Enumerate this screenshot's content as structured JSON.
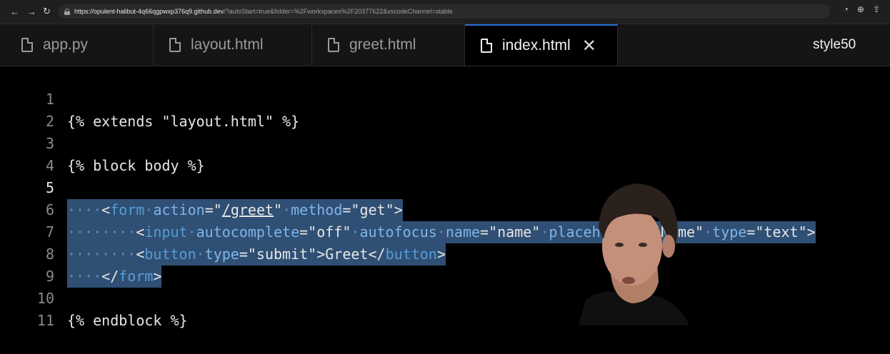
{
  "browser": {
    "url_host": "https://opulent-halibut-4q66qgpwxp376q9.github.dev",
    "url_rest": "/?autoStart=true&folder=%2Fworkspaces%2F20377622&vscodeChannel=stable"
  },
  "tabs": [
    {
      "label": "app.py"
    },
    {
      "label": "layout.html"
    },
    {
      "label": "greet.html"
    },
    {
      "label": "index.html"
    }
  ],
  "status_right": "style50",
  "editor": {
    "line_numbers": [
      "1",
      "2",
      "3",
      "4",
      "5",
      "6",
      "7",
      "8",
      "9",
      "10",
      "11"
    ],
    "lines": {
      "l1": "{% extends \"layout.html\" %}",
      "l3": "{% block body %}",
      "l5": {
        "ws": "····",
        "lt": "<",
        "tag": "form",
        "s1": "·",
        "a1": "action",
        "eq1": "=\"",
        "v1": "/greet",
        "q1": "\"",
        "s2": "·",
        "a2": "method",
        "eq2": "=\"",
        "v2": "get",
        "end": "\">"
      },
      "l6": {
        "ws": "········",
        "lt": "<",
        "tag": "input",
        "s1": "·",
        "a1": "autocomplete",
        "eq1": "=\"off\"",
        "s2": "·",
        "a2": "autofocus",
        "s3": "·",
        "a3": "name",
        "eq3": "=\"name\"",
        "s4": "·",
        "a4": "placeholder",
        "eq4": "=\"Name\"",
        "s5": "·",
        "a5": "type",
        "eq5": "=\"text\">"
      },
      "l7": {
        "ws": "········",
        "lt": "<",
        "tag": "button",
        "s1": "·",
        "a1": "type",
        "eq1": "=\"submit\">",
        "text": "Greet",
        "close_lt": "</",
        "close_tag": "button",
        "gt": ">"
      },
      "l8": {
        "ws": "····",
        "lt": "</",
        "tag": "form",
        "gt": ">"
      },
      "l10": "{% endblock %}"
    }
  },
  "colors": {
    "selection": "#2f4f74",
    "tag": "#569cd6",
    "attr": "#7fb5e8",
    "active_tab_border": "#2a6fd6"
  }
}
